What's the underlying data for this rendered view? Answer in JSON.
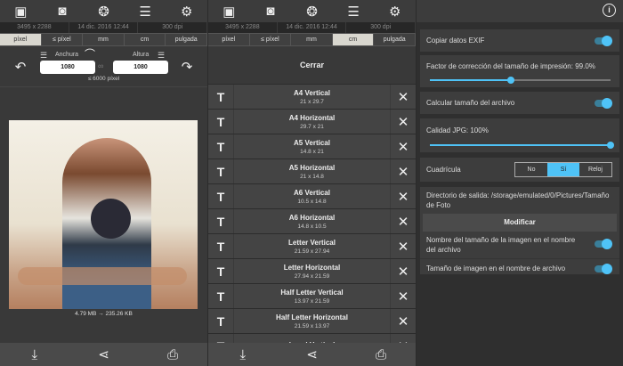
{
  "toolbar": {
    "icons": [
      "gallery-icon",
      "camera-icon",
      "palette-icon",
      "sliders-icon",
      "gear-icon"
    ]
  },
  "info": {
    "dimensions": "3495 x 2288",
    "date": "14 dic. 2016 12:44",
    "dpi": "300 dpi"
  },
  "units": [
    "píxel",
    "≤ píxel",
    "mm",
    "cm",
    "pulgada"
  ],
  "resize": {
    "width_label": "Anchura",
    "width_value": "1080",
    "height_label": "Altura",
    "height_value": "1080",
    "limit": "≤ 6000 píxel"
  },
  "photo": {
    "size_caption": "4.79 MB → 235.26 KB"
  },
  "presets": {
    "close_label": "Cerrar",
    "items": [
      {
        "name": "A4 Vertical",
        "dims": "21 x 29.7"
      },
      {
        "name": "A4 Horizontal",
        "dims": "29.7 x 21"
      },
      {
        "name": "A5 Vertical",
        "dims": "14.8 x 21"
      },
      {
        "name": "A5 Horizontal",
        "dims": "21 x 14.8"
      },
      {
        "name": "A6 Vertical",
        "dims": "10.5 x 14.8"
      },
      {
        "name": "A6 Horizontal",
        "dims": "14.8 x 10.5"
      },
      {
        "name": "Letter Vertical",
        "dims": "21.59 x 27.94"
      },
      {
        "name": "Letter Horizontal",
        "dims": "27.94 x 21.59"
      },
      {
        "name": "Half Letter Vertical",
        "dims": "13.97 x 21.59"
      },
      {
        "name": "Half Letter Horizontal",
        "dims": "21.59 x 13.97"
      },
      {
        "name": "Legal Vertical",
        "dims": ""
      }
    ]
  },
  "settings": {
    "exif": {
      "label": "Copiar datos EXIF",
      "on": true
    },
    "print_factor": {
      "label": "Factor de corrección del tamaño de impresión: 99.0%",
      "fraction": 0.45
    },
    "calc_size": {
      "label": "Calcular tamaño del archivo",
      "on": true
    },
    "jpg_quality": {
      "label": "Calidad JPG: 100%",
      "fraction": 1.0
    },
    "grid": {
      "label": "Cuadrícula",
      "options": [
        "No",
        "Sí",
        "Reloj"
      ],
      "selected": "Sí"
    },
    "output_dir": {
      "label": "Directorio de salida: /storage/emulated/0/Pictures/Tamaño de Foto",
      "button": "Modificar"
    },
    "size_name_in_filename": {
      "label": "Nombre del tamaño de la imagen en el nombre del archivo",
      "on": true
    },
    "image_size_in_filename": {
      "label": "Tamaño de imagen en el nombre de archivo",
      "on": true
    }
  },
  "colors": {
    "accent": "#4fc3f7"
  }
}
